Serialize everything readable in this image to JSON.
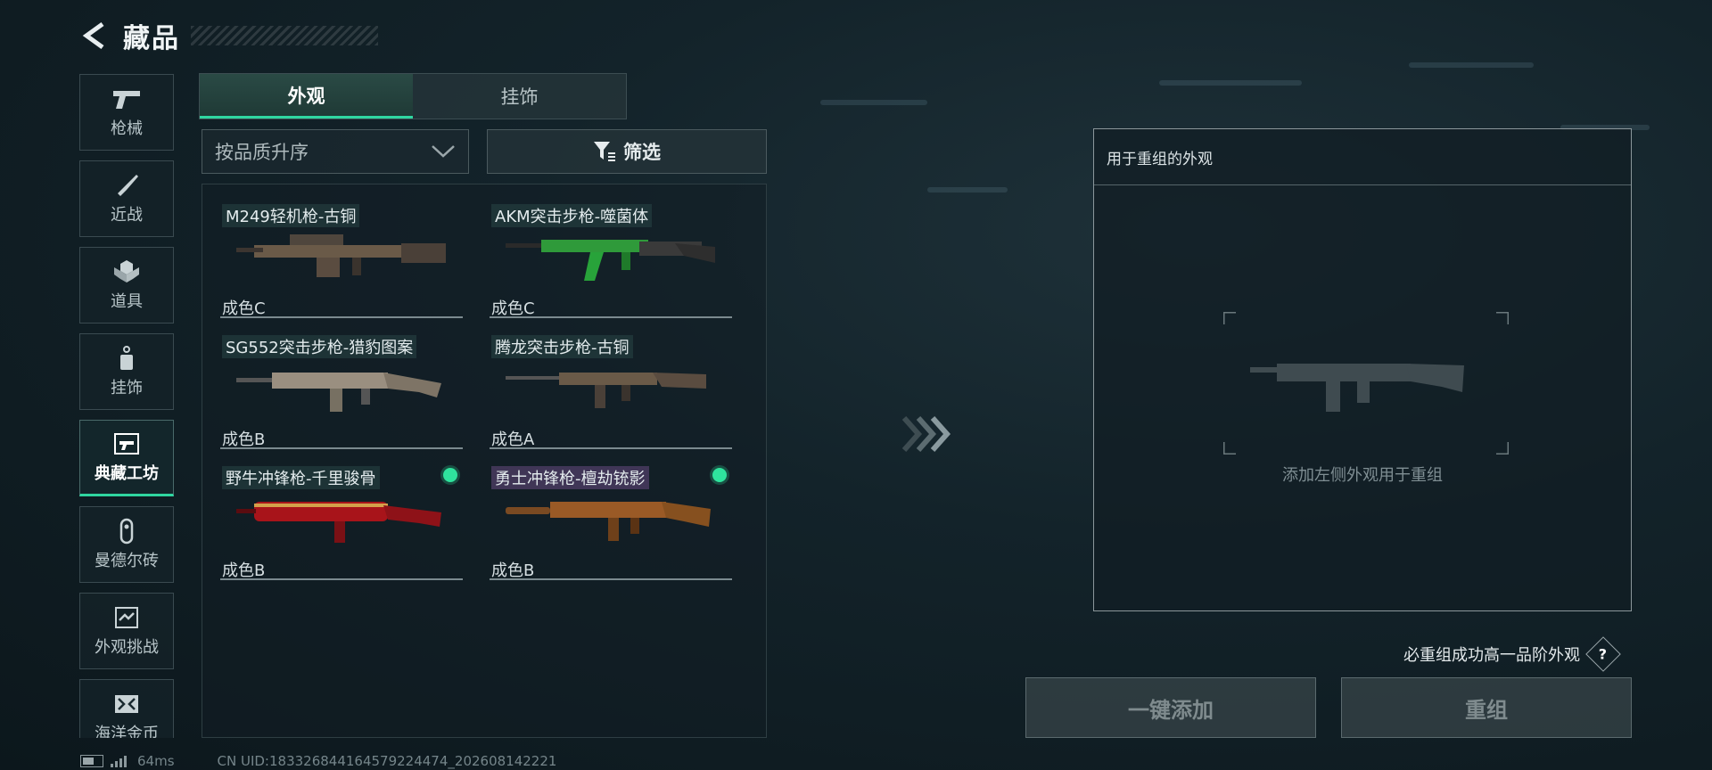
{
  "header": {
    "title": "藏品"
  },
  "sidebar": {
    "items": [
      {
        "label": "枪械",
        "icon": "pistol-icon"
      },
      {
        "label": "近战",
        "icon": "knife-icon"
      },
      {
        "label": "道具",
        "icon": "grenade-icon"
      },
      {
        "label": "挂饰",
        "icon": "charm-icon"
      },
      {
        "label": "典藏工坊",
        "icon": "workshop-icon",
        "active": true
      },
      {
        "label": "曼德尔砖",
        "icon": "brick-icon"
      },
      {
        "label": "外观挑战",
        "icon": "challenge-icon"
      },
      {
        "label": "海洋金币",
        "icon": "coin-icon"
      }
    ]
  },
  "tabs": [
    {
      "label": "外观",
      "active": true
    },
    {
      "label": "挂饰",
      "active": false
    }
  ],
  "sort": {
    "label": "按品质升序"
  },
  "filter": {
    "label": "筛选"
  },
  "items": [
    {
      "name": "M249轻机枪-古铜",
      "condition": "成色C",
      "tag": "teal",
      "owned_dot": false
    },
    {
      "name": "AKM突击步枪-噬菌体",
      "condition": "成色C",
      "tag": "teal",
      "owned_dot": false
    },
    {
      "name": "SG552突击步枪-猎豹图案",
      "condition": "成色B",
      "tag": "teal",
      "owned_dot": false
    },
    {
      "name": "腾龙突击步枪-古铜",
      "condition": "成色A",
      "tag": "teal",
      "owned_dot": false
    },
    {
      "name": "野牛冲锋枪-千里骏骨",
      "condition": "成色B",
      "tag": "teal",
      "owned_dot": true
    },
    {
      "name": "勇士冲锋枪-檀劫铳影",
      "condition": "成色B",
      "tag": "purple",
      "owned_dot": true
    }
  ],
  "recombine": {
    "header": "用于重组的外观",
    "hint": "添加左侧外观用于重组"
  },
  "note": "必重组成功高一品阶外观",
  "buttons": {
    "quick_add": "一键添加",
    "recombine": "重组"
  },
  "status": {
    "ping": "64ms",
    "uid": "CN UID:18332684416457922447­4_202608142221"
  },
  "colors": {
    "accent": "#2fd6a0",
    "dot": "#2fe39d"
  }
}
